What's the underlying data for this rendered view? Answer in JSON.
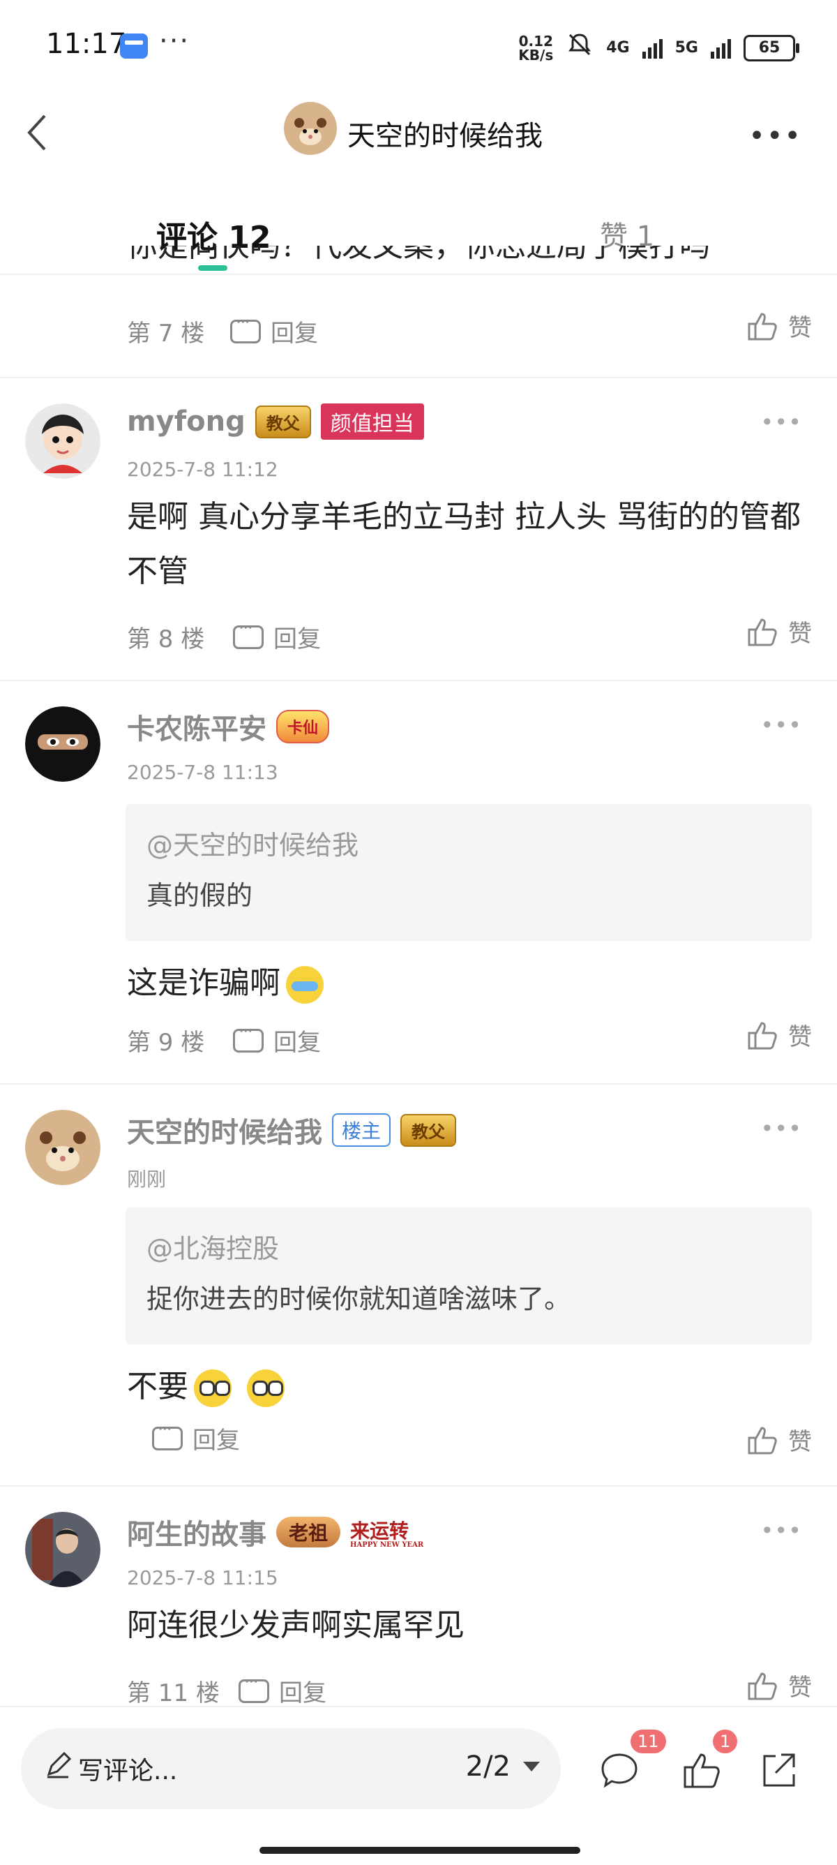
{
  "status_bar": {
    "time": "11:17",
    "net_speed_top": "0.12",
    "net_speed_bottom": "KB/s",
    "net_4g": "4G",
    "net_5g": "5G",
    "battery": "65"
  },
  "header": {
    "title": "天空的时候给我",
    "more": "•••"
  },
  "tabs": [
    {
      "label": "评论 12",
      "active": true
    },
    {
      "label": "赞 1",
      "active": false
    }
  ],
  "partial_comment": {
    "text": "你是同伙吗？代发文案，你忘近局了模打吗",
    "floor": "第 7 楼",
    "reply": "回复",
    "like": "赞"
  },
  "comments": [
    {
      "username": "myfong",
      "badges": [
        "教父",
        "颜值担当"
      ],
      "time": "2025-7-8 11:12",
      "text": "是啊 真心分享羊毛的立马封 拉人头 骂街的的管都不管",
      "floor": "第 8 楼",
      "reply": "回复",
      "like": "赞"
    },
    {
      "username": "卡农陈平安",
      "badges": [
        "卡仙"
      ],
      "time": "2025-7-8 11:13",
      "quote_user": "@天空的时候给我",
      "quote_text": "真的假的",
      "text": "这是诈骗啊",
      "floor": "第 9 楼",
      "reply": "回复",
      "like": "赞"
    },
    {
      "username": "天空的时候给我",
      "badges": [
        "楼主",
        "教父"
      ],
      "time": "刚刚",
      "quote_user": "@北海控股",
      "quote_text": "捉你进去的时候你就知道啥滋味了。",
      "text": "不要",
      "reply": "回复",
      "like": "赞"
    },
    {
      "username": "阿生的故事",
      "badges": [
        "老祖",
        "来运转",
        "HAPPY NEW YEAR"
      ],
      "time": "2025-7-8 11:15",
      "text": "阿连很少发声啊实属罕见",
      "floor": "第 11 楼",
      "reply": "回复",
      "like": "赞"
    }
  ],
  "bottom_bar": {
    "input_placeholder": "写评论...",
    "page": "2/2",
    "comment_count": "11",
    "like_count": "1"
  },
  "icons": [
    "back-icon",
    "more-icon",
    "reply-icon",
    "thumb-up-icon",
    "pencil-icon",
    "comment-bubble-icon",
    "share-icon"
  ],
  "colors": {
    "accent": "#2dbf98",
    "badge_red": "#d9355a",
    "count_badge": "#f06f73"
  }
}
